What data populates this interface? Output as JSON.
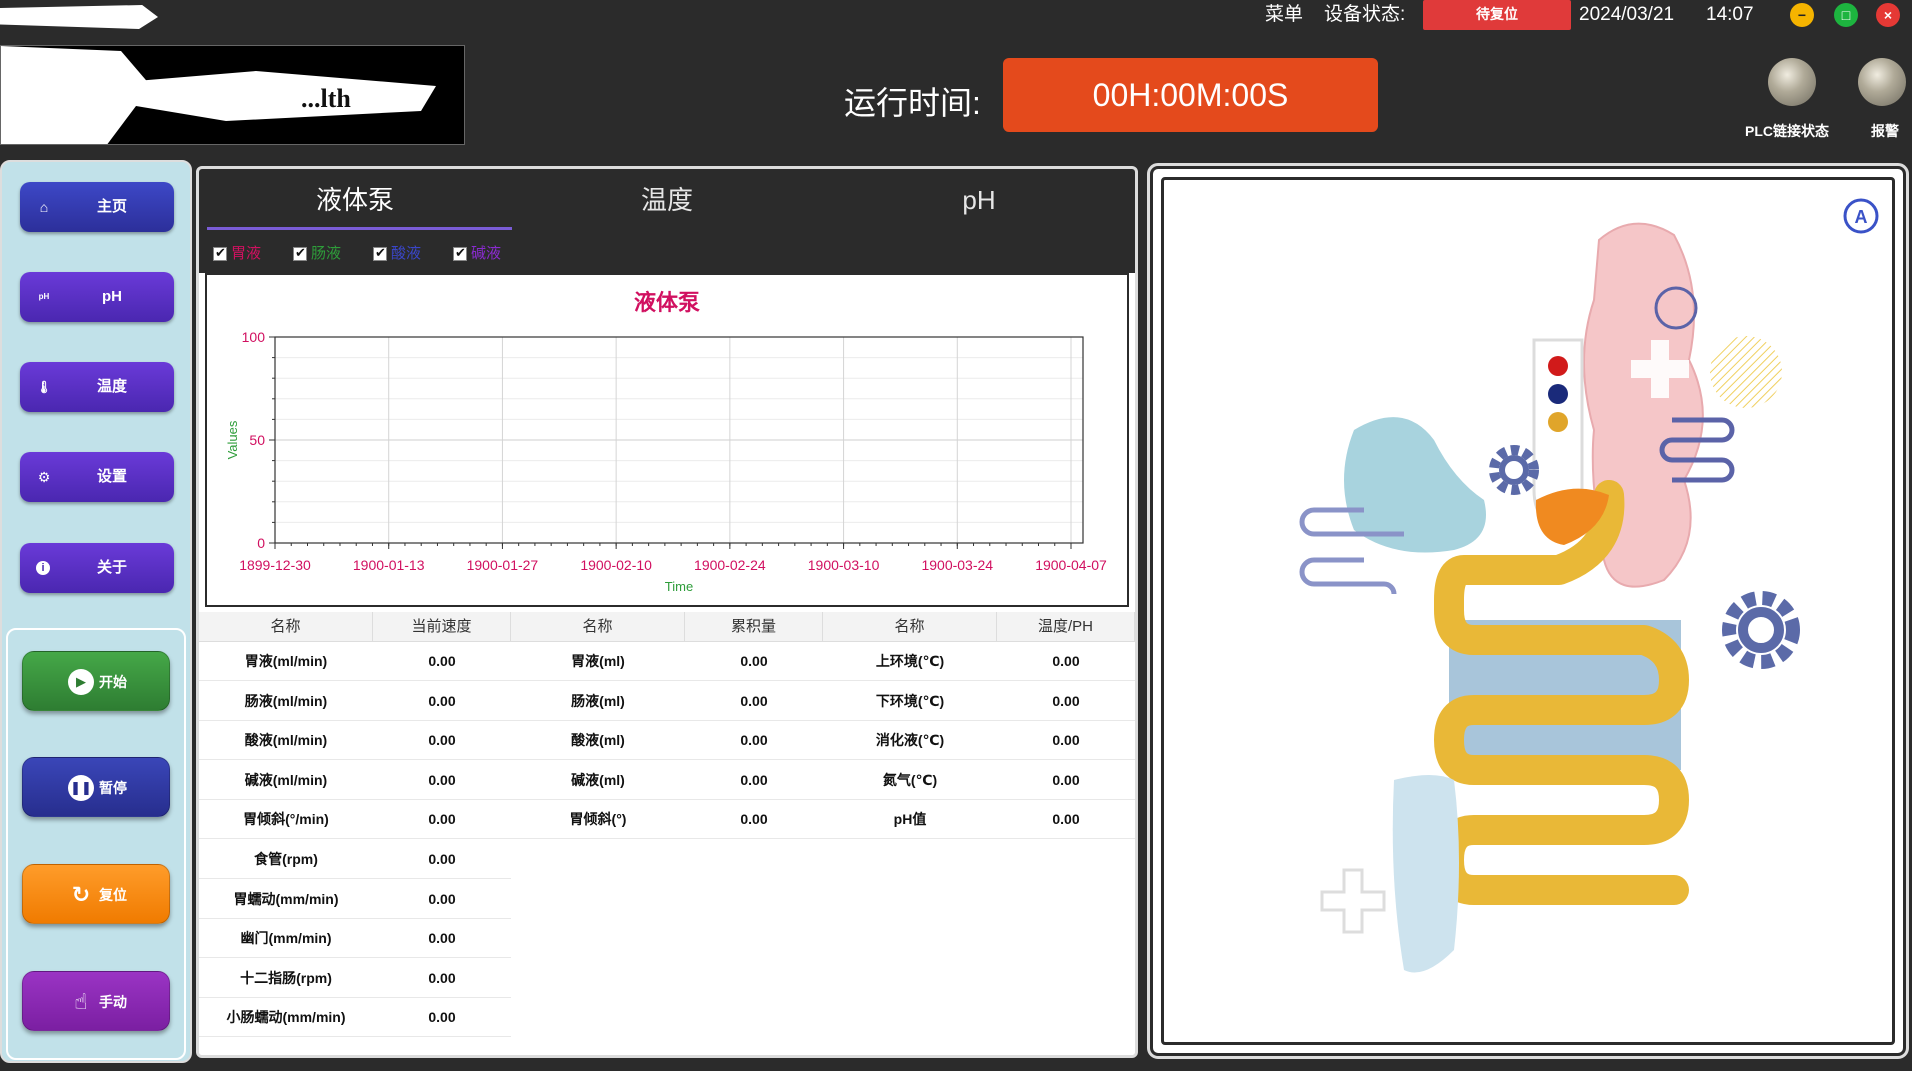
{
  "titlebar": {
    "menu": "菜单",
    "status_label": "设备状态:",
    "status_value": "待复位",
    "date": "2024/03/21",
    "time": "14:07",
    "minimize": "−",
    "maximize": "□",
    "close": "×"
  },
  "header": {
    "logo_text": "...lth",
    "runtime_label": "运行时间:",
    "runtime_value": "00H:00M:00S",
    "plc_label": "PLC链接状态",
    "alarm_label": "报警"
  },
  "sidebar": {
    "items": [
      {
        "label": "主页",
        "icon": "home-icon",
        "glyph": "⌂"
      },
      {
        "label": "pH",
        "icon": "ph-icon",
        "glyph": "pH"
      },
      {
        "label": "温度",
        "icon": "thermometer-icon",
        "glyph": "🌡"
      },
      {
        "label": "设置",
        "icon": "gear-icon",
        "glyph": "⚙"
      },
      {
        "label": "关于",
        "icon": "info-icon",
        "glyph": "i"
      }
    ],
    "controls": {
      "start": "开始",
      "pause": "暂停",
      "reset": "复位",
      "manual": "手动"
    }
  },
  "tabs": {
    "pump": "液体泵",
    "temp": "温度",
    "ph": "pH"
  },
  "series_toggles": [
    {
      "label": "胃液",
      "color": "#d11060",
      "checked": true
    },
    {
      "label": "肠液",
      "color": "#2e9d3a",
      "checked": true
    },
    {
      "label": "酸液",
      "color": "#3a46c8",
      "checked": true
    },
    {
      "label": "碱液",
      "color": "#8a2bd0",
      "checked": true
    }
  ],
  "chart_data": {
    "type": "line",
    "title": "液体泵",
    "xlabel": "Time",
    "ylabel": "Values",
    "ylim": [
      0,
      100
    ],
    "yticks": [
      "0",
      "50",
      "100"
    ],
    "xticks": [
      "1899-12-30",
      "1900-01-13",
      "1900-01-27",
      "1900-02-10",
      "1900-02-24",
      "1900-03-10",
      "1900-03-24",
      "1900-04-07"
    ],
    "grid": true,
    "series": []
  },
  "table_pump": {
    "headers": [
      "名称",
      "当前速度"
    ],
    "rows": [
      [
        "胃液(ml/min)",
        "0.00"
      ],
      [
        "肠液(ml/min)",
        "0.00"
      ],
      [
        "酸液(ml/min)",
        "0.00"
      ],
      [
        "碱液(ml/min)",
        "0.00"
      ],
      [
        "胃倾斜(°/min)",
        "0.00"
      ],
      [
        "食管(rpm)",
        "0.00"
      ],
      [
        "胃蠕动(mm/min)",
        "0.00"
      ],
      [
        "幽门(mm/min)",
        "0.00"
      ],
      [
        "十二指肠(rpm)",
        "0.00"
      ],
      [
        "小肠蠕动(mm/min)",
        "0.00"
      ]
    ]
  },
  "table_volume": {
    "headers": [
      "名称",
      "累积量"
    ],
    "rows": [
      [
        "胃液(ml)",
        "0.00"
      ],
      [
        "肠液(ml)",
        "0.00"
      ],
      [
        "酸液(ml)",
        "0.00"
      ],
      [
        "碱液(ml)",
        "0.00"
      ],
      [
        "胃倾斜(°)",
        "0.00"
      ]
    ]
  },
  "table_env": {
    "headers": [
      "名称",
      "温度/PH"
    ],
    "rows": [
      [
        "上环境(℃)",
        "0.00"
      ],
      [
        "下环境(℃)",
        "0.00"
      ],
      [
        "消化液(℃)",
        "0.00"
      ],
      [
        "氮气(℃)",
        "0.00"
      ],
      [
        "pH值",
        "0.00"
      ]
    ]
  },
  "colors": {
    "accent_purple": "#5b2fc4",
    "start_green": "#2e7d32",
    "reset_orange": "#f07b00",
    "manual_purple": "#7b1fa2",
    "runtime_orange": "#e44a1c",
    "status_red": "#e03a3a"
  }
}
